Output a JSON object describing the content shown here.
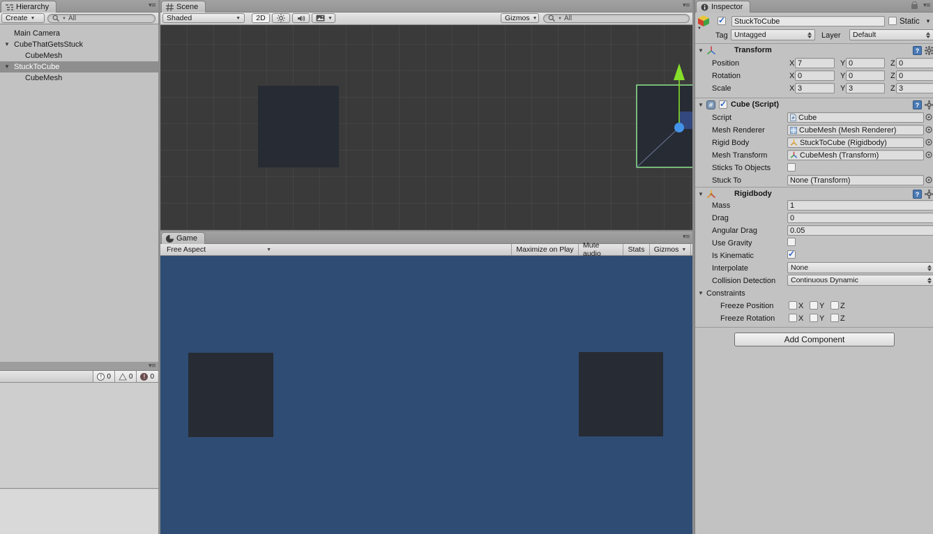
{
  "hierarchy": {
    "tab_label": "Hierarchy",
    "create_label": "Create",
    "search_text": "All",
    "items": [
      {
        "label": "Main Camera",
        "selected": false
      },
      {
        "label": "CubeThatGetsStuck",
        "selected": false
      },
      {
        "label": "CubeMesh",
        "selected": false
      },
      {
        "label": "StuckToCube",
        "selected": true
      },
      {
        "label": "CubeMesh",
        "selected": false
      }
    ]
  },
  "console": {
    "info_count": "0",
    "warning_count": "0",
    "error_count": "0"
  },
  "scene": {
    "tab_label": "Scene",
    "draw_mode": "Shaded",
    "toggle_2d": "2D",
    "gizmos_label": "Gizmos",
    "search_text": "All"
  },
  "game": {
    "tab_label": "Game",
    "aspect": "Free Aspect",
    "maximize_label": "Maximize on Play",
    "mute_label": "Mute audio",
    "stats_label": "Stats",
    "gizmos_label": "Gizmos"
  },
  "inspector": {
    "tab_label": "Inspector",
    "object_name": "StuckToCube",
    "active_checked": true,
    "static_label": "Static",
    "tag_label": "Tag",
    "tag_value": "Untagged",
    "layer_label": "Layer",
    "layer_value": "Default",
    "transform": {
      "title": "Transform",
      "axis": {
        "x": "X",
        "y": "Y",
        "z": "Z"
      },
      "rows": [
        {
          "label": "Position",
          "x": "7",
          "y": "0",
          "z": "0"
        },
        {
          "label": "Rotation",
          "x": "0",
          "y": "0",
          "z": "0"
        },
        {
          "label": "Scale",
          "x": "3",
          "y": "3",
          "z": "3"
        }
      ]
    },
    "cube_script": {
      "title": "Cube (Script)",
      "enabled_checked": true,
      "script_label": "Script",
      "script_value": "Cube",
      "mesh_renderer_label": "Mesh Renderer",
      "mesh_renderer_value": "CubeMesh (Mesh Renderer)",
      "rigid_body_label": "Rigid Body",
      "rigid_body_value": "StuckToCube (Rigidbody)",
      "mesh_transform_label": "Mesh Transform",
      "mesh_transform_value": "CubeMesh (Transform)",
      "sticks_label": "Sticks To Objects",
      "sticks_checked": false,
      "stuck_to_label": "Stuck To",
      "stuck_to_value": "None (Transform)"
    },
    "rigidbody": {
      "title": "Rigidbody",
      "mass_label": "Mass",
      "mass_value": "1",
      "drag_label": "Drag",
      "drag_value": "0",
      "angular_drag_label": "Angular Drag",
      "angular_drag_value": "0.05",
      "use_gravity_label": "Use Gravity",
      "use_gravity_checked": false,
      "is_kinematic_label": "Is Kinematic",
      "is_kinematic_checked": true,
      "interpolate_label": "Interpolate",
      "interpolate_value": "None",
      "collision_label": "Collision Detection",
      "collision_value": "Continuous Dynamic",
      "constraints_label": "Constraints",
      "freeze_position_label": "Freeze Position",
      "freeze_rotation_label": "Freeze Rotation",
      "axis": {
        "x": "X",
        "y": "Y",
        "z": "Z"
      },
      "freeze_position": {
        "x": false,
        "y": false,
        "z": false
      },
      "freeze_rotation": {
        "x": false,
        "y": false,
        "z": false
      }
    },
    "add_component_label": "Add Component"
  },
  "colors": {
    "game_background": "#2f4d74",
    "scene_background": "#3a3a3a",
    "scene_cube": "#272b33",
    "selection_outline": "#8fe88f",
    "axis_green": "#86df2b",
    "handle_blue": "#4493ea",
    "check_blue": "#2a62c8"
  },
  "icons": {
    "hierarchy_tab": "list-icon",
    "scene_tab": "grid-hash-icon",
    "game_tab": "game-view-icon",
    "inspector_tab": "info-circle-icon",
    "search": "magnifier-icon",
    "lock": "padlock-open-icon",
    "panel_menu": "dropdown-hamburger-icon",
    "help": "question-book-icon",
    "settings": "gear-icon",
    "object_picker": "target-circle-icon"
  }
}
